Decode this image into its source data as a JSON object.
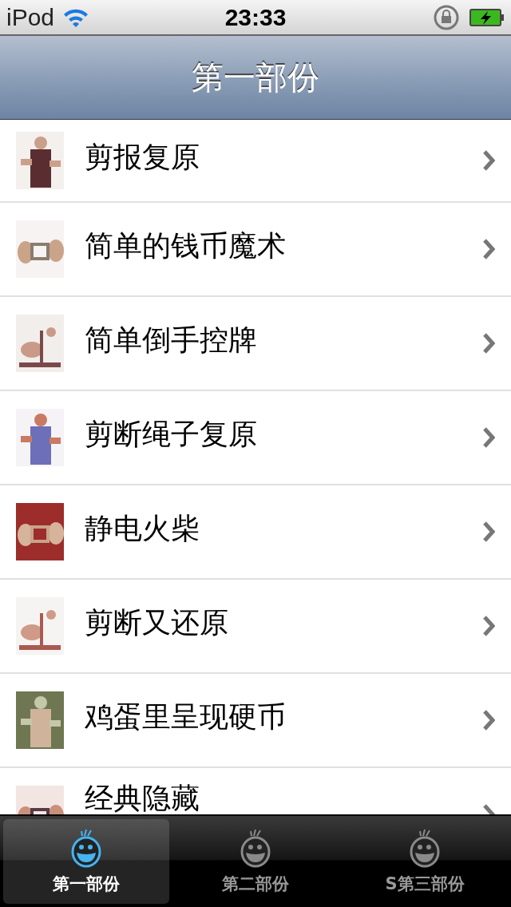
{
  "status_bar": {
    "carrier": "iPod",
    "time": "23:33"
  },
  "nav_bar": {
    "title": "第一部份"
  },
  "rows": [
    {
      "label": "剪报复原"
    },
    {
      "label": "简单的钱币魔术"
    },
    {
      "label": "简单倒手控牌"
    },
    {
      "label": "剪断绳子复原"
    },
    {
      "label": "静电火柴"
    },
    {
      "label": "剪断又还原"
    },
    {
      "label": "鸡蛋里呈现硬币"
    },
    {
      "label": "经典隐藏"
    }
  ],
  "tab_bar": {
    "tabs": [
      {
        "label": "第一部份",
        "selected": true
      },
      {
        "label": "第二部份",
        "selected": false
      },
      {
        "label": "S第三部份",
        "selected": false
      }
    ]
  }
}
